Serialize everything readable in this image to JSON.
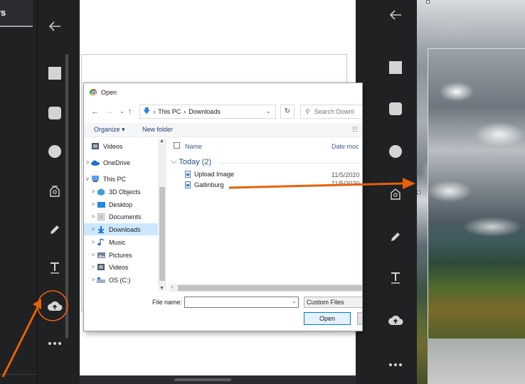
{
  "left_panel": {
    "tab_label": "rs"
  },
  "toolbar": {
    "back": "back-arrow-icon",
    "tools": [
      "square-icon",
      "rounded-square-icon",
      "circle-icon",
      "tag-icon",
      "pencil-icon",
      "text-icon",
      "cloud-upload-icon",
      "more-icon"
    ]
  },
  "dialog": {
    "title": "Open",
    "breadcrumb": [
      "This PC",
      "Downloads"
    ],
    "search_placeholder": "Search Downl",
    "organize_label": "Organize ▾",
    "new_folder_label": "New folder",
    "nav_items": [
      {
        "label": "Videos",
        "chevron": "",
        "icon": "video"
      },
      {
        "label": "OneDrive",
        "chevron": ">",
        "icon": "cloud"
      },
      {
        "label": "This PC",
        "chevron": "v",
        "icon": "pc"
      },
      {
        "label": "3D Objects",
        "chevron": ">",
        "icon": "cube"
      },
      {
        "label": "Desktop",
        "chevron": ">",
        "icon": "desktop"
      },
      {
        "label": "Documents",
        "chevron": ">",
        "icon": "docs"
      },
      {
        "label": "Downloads",
        "chevron": ">",
        "icon": "download"
      },
      {
        "label": "Music",
        "chevron": ">",
        "icon": "music"
      },
      {
        "label": "Pictures",
        "chevron": ">",
        "icon": "pictures"
      },
      {
        "label": "Videos",
        "chevron": ">",
        "icon": "video"
      },
      {
        "label": "OS (C:)",
        "chevron": ">",
        "icon": "drive"
      }
    ],
    "selected_nav": "Downloads",
    "columns": {
      "name": "Name",
      "date": "Date moc"
    },
    "group_label": "Today (2)",
    "files": [
      {
        "name": "Upload Image",
        "date": "11/5/2020"
      },
      {
        "name": "Gatlinburg",
        "date": "11/5/2020"
      }
    ],
    "file_name_label": "File name:",
    "file_name_value": "",
    "filter_label": "Custom Files",
    "open_button": "Open"
  },
  "colors": {
    "accent": "#e8600a",
    "toolbar_bg": "#1f2123",
    "selection": "#cce8ff"
  }
}
